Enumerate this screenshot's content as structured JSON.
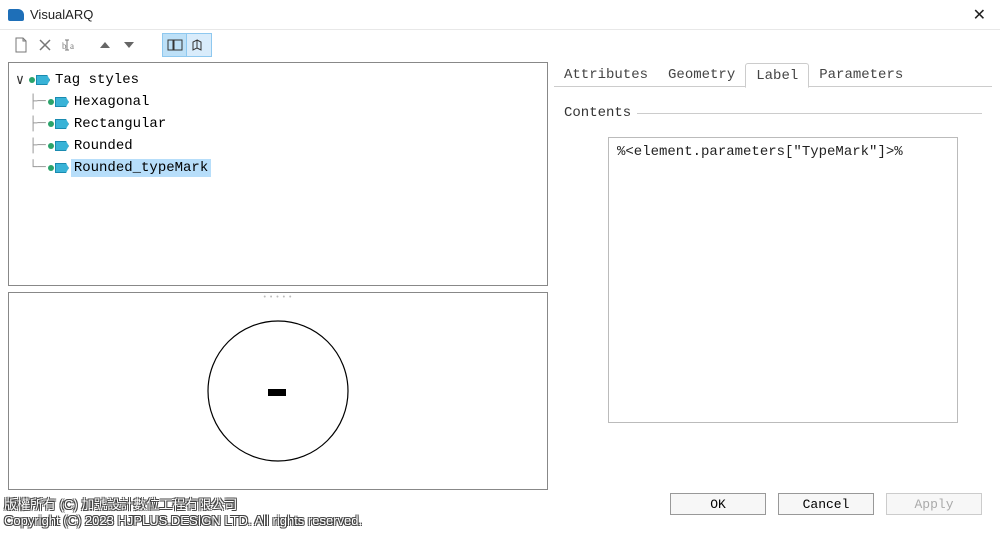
{
  "window": {
    "title": "VisualARQ"
  },
  "tree": {
    "root_label": "Tag styles",
    "items": [
      {
        "label": "Hexagonal"
      },
      {
        "label": "Rectangular"
      },
      {
        "label": "Rounded"
      },
      {
        "label": "Rounded_typeMark",
        "selected": true
      }
    ]
  },
  "tabs": {
    "items": [
      {
        "label": "Attributes"
      },
      {
        "label": "Geometry"
      },
      {
        "label": "Label",
        "active": true
      },
      {
        "label": "Parameters"
      }
    ],
    "contents_title": "Contents",
    "contents_value": "%<element.parameters[\"TypeMark\"]>%"
  },
  "buttons": {
    "ok": "OK",
    "cancel": "Cancel",
    "apply": "Apply"
  },
  "footer": {
    "line1": "版權所有 (C) 加號設計數位工程有限公司",
    "line2": "Copyright (C) 2023 HJPLUS.DESIGN LTD. All rights reserved."
  }
}
